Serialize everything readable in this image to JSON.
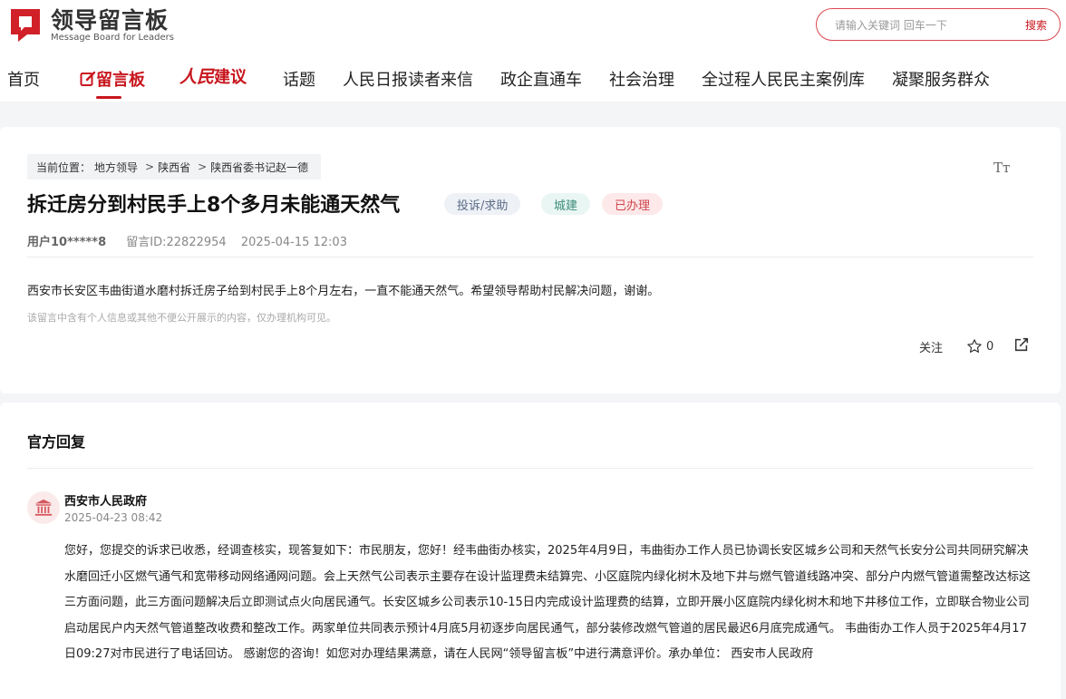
{
  "header": {
    "logo_cn": "领导留言板",
    "logo_en": "Message Board for Leaders",
    "search_placeholder": "请输入关键词 回车一下",
    "search_button": "搜索"
  },
  "nav": {
    "home": "首页",
    "message_board": "留言板",
    "renmin": "人民",
    "jianyi": "建议",
    "topics": "话题",
    "reader_letters": "人民日报读者来信",
    "business_direct": "政企直通车",
    "social_governance": "社会治理",
    "democracy_cases": "全过程人民民主案例库",
    "service_groups": "凝聚服务群众"
  },
  "message": {
    "breadcrumb_prefix": "当前位置：",
    "breadcrumb": [
      "地方领导",
      "陕西省",
      "陕西省委书记赵一德"
    ],
    "font_size_icon_label": "Tт",
    "title": "拆迁房分到村民手上8个多月未能通天然气",
    "tags": [
      "投诉/求助",
      "城建",
      "已办理"
    ],
    "user": "用户10*****8",
    "message_id": "留言ID:22822954",
    "date": "2025-04-15 12:03",
    "content": "西安市长安区韦曲街道水磨村拆迁房子给到村民手上8个月左右，一直不能通天然气。希望领导帮助村民解决问题，谢谢。",
    "notice": "该留言中含有个人信息或其他不便公开展示的内容，仅办理机构可见。",
    "follow_label": "关注",
    "star_count": "0"
  },
  "reply": {
    "section_title": "官方回复",
    "org": "西安市人民政府",
    "time": "2025-04-23 08:42",
    "body": " 您好，您提交的诉求已收悉，经调查核实，现答复如下：市民朋友，您好！经韦曲街办核实，2025年4月9日，韦曲街办工作人员已协调长安区城乡公司和天然气长安分公司共同研究解决水磨回迁小区燃气通气和宽带移动网络通网问题。会上天然气公司表示主要存在设计监理费未结算完、小区庭院内绿化树木及地下井与燃气管道线路冲突、部分户内燃气管道需整改达标这三方面问题，此三方面问题解决后立即测试点火向居民通气。长安区城乡公司表示10-15日内完成设计监理费的结算，立即开展小区庭院内绿化树木和地下井移位工作，立即联合物业公司启动居民户内天然气管道整改收费和整改工作。两家单位共同表示预计4月底5月初逐步向居民通气，部分装修改燃气管道的居民最迟6月底完成通气。  韦曲街办工作人员于2025年4月17日09:27对市民进行了电话回访。 感谢您的咨询！如您对办理结果满意，请在人民网“领导留言板”中进行满意评价。承办单位：  西安市人民政府"
  },
  "colors": {
    "brand_red": "#c8161e",
    "page_bg": "#f4f5f7"
  }
}
